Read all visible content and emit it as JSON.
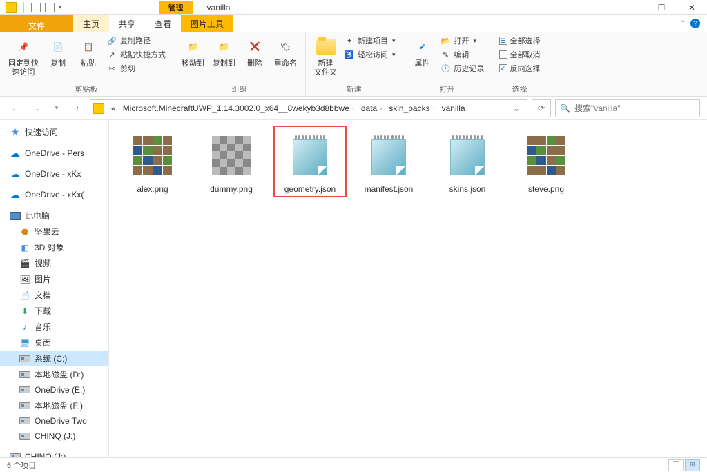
{
  "window": {
    "title": "vanilla",
    "manage_tab": "管理"
  },
  "ribbon_tabs": {
    "file": "文件",
    "home": "主页",
    "share": "共享",
    "view": "查看",
    "picture_tools": "图片工具"
  },
  "ribbon": {
    "clipboard": {
      "pin": "固定到快\n速访问",
      "copy": "复制",
      "paste": "粘贴",
      "copy_path": "复制路径",
      "paste_shortcut": "粘贴快捷方式",
      "cut": "剪切",
      "label": "剪贴板"
    },
    "organize": {
      "move_to": "移动到",
      "copy_to": "复制到",
      "delete": "删除",
      "rename": "重命名",
      "label": "组织"
    },
    "new": {
      "new_folder": "新建\n文件夹",
      "new_item": "新建项目",
      "easy_access": "轻松访问",
      "label": "新建"
    },
    "open": {
      "properties": "属性",
      "open": "打开",
      "edit": "编辑",
      "history": "历史记录",
      "label": "打开"
    },
    "select": {
      "select_all": "全部选择",
      "select_none": "全部取消",
      "invert": "反向选择",
      "label": "选择"
    }
  },
  "breadcrumb": {
    "prefix": "«",
    "p1": "Microsoft.MinecraftUWP_1.14.3002.0_x64__8wekyb3d8bbwe",
    "p2": "data",
    "p3": "skin_packs",
    "p4": "vanilla"
  },
  "search_placeholder": "搜索\"vanilla\"",
  "nav": {
    "quick_access": "快速访问",
    "onedrive_pers": "OneDrive - Pers",
    "onedrive_xkx": "OneDrive - xKx",
    "onedrive_xkx2": "OneDrive - xKx(",
    "this_pc": "此电脑",
    "jianguo": "坚果云",
    "objects3d": "3D 对象",
    "videos": "视频",
    "pictures": "图片",
    "documents": "文档",
    "downloads": "下载",
    "music": "音乐",
    "desktop": "桌面",
    "system_c": "系统 (C:)",
    "local_d": "本地磁盘 (D:)",
    "onedrive_e": "OneDrive (E:)",
    "local_f": "本地磁盘 (F:)",
    "onedrive_two": "OneDrive Two",
    "chinq_j": "CHINQ (J:)",
    "chinq_j2": "CHINQ (J:)"
  },
  "files": [
    {
      "name": "alex.png",
      "type": "png-skin"
    },
    {
      "name": "dummy.png",
      "type": "png-dummy"
    },
    {
      "name": "geometry.json",
      "type": "json",
      "highlighted": true
    },
    {
      "name": "manifest.json",
      "type": "json"
    },
    {
      "name": "skins.json",
      "type": "json"
    },
    {
      "name": "steve.png",
      "type": "png-skin"
    }
  ],
  "status": {
    "count": "6 个项目"
  }
}
